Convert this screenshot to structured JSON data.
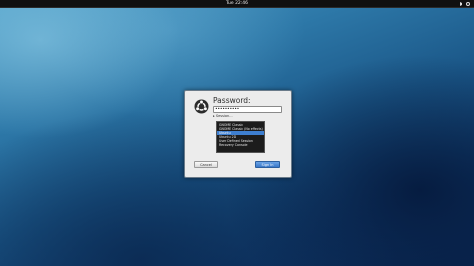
{
  "top_bar": {
    "clock": "Tue 22:46",
    "icons": [
      "volume-icon",
      "power-icon"
    ]
  },
  "login_dialog": {
    "logo_icon": "ubuntu-logo-icon",
    "password_label": "Password:",
    "password_value": "••••••••••",
    "session_toggle": "▸ Session...",
    "session_options": [
      "GNOME Classic",
      "GNOME Classic (No effects)",
      "Ubuntu",
      "Ubuntu 2D",
      "User Defined Session",
      "Recovery Console"
    ],
    "selected_session_index": 2,
    "cancel_label": "Cancel",
    "signin_label": "Sign In"
  }
}
